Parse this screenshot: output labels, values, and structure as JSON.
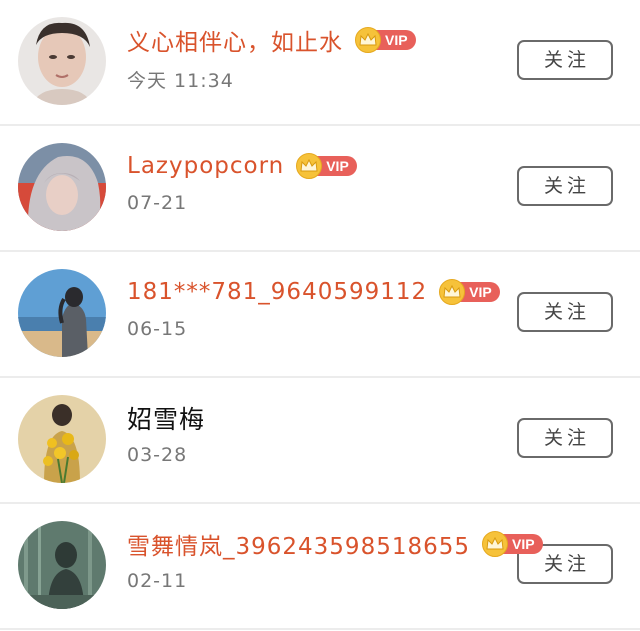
{
  "colors": {
    "name_vip": "#d9532c",
    "name_plain": "#111111",
    "time": "#777777",
    "vip_badge": "#e8605a",
    "crown": "#f6c23a",
    "button_border": "#6a6a6a",
    "divider": "#ececec"
  },
  "users": [
    {
      "name": "义心相伴心，如止水",
      "vip": true,
      "vip_label": "VIP",
      "time": "今天 11:34",
      "follow_label": "关注",
      "avatar_icon": "user-portrait-icon"
    },
    {
      "name": "Lazypopcorn",
      "vip": true,
      "vip_label": "VIP",
      "time": "07-21",
      "follow_label": "关注",
      "avatar_icon": "user-portrait-icon"
    },
    {
      "name": "181***781_9640599112",
      "vip": true,
      "vip_label": "VIP",
      "time": "06-15",
      "follow_label": "关注",
      "avatar_icon": "user-portrait-icon"
    },
    {
      "name": "妱雪梅",
      "vip": false,
      "vip_label": "",
      "time": "03-28",
      "follow_label": "关注",
      "avatar_icon": "user-portrait-icon"
    },
    {
      "name": "雪舞情岚_396243598518655",
      "vip": true,
      "vip_label": "VIP",
      "time": "02-11",
      "follow_label": "关注",
      "avatar_icon": "user-portrait-icon"
    }
  ]
}
